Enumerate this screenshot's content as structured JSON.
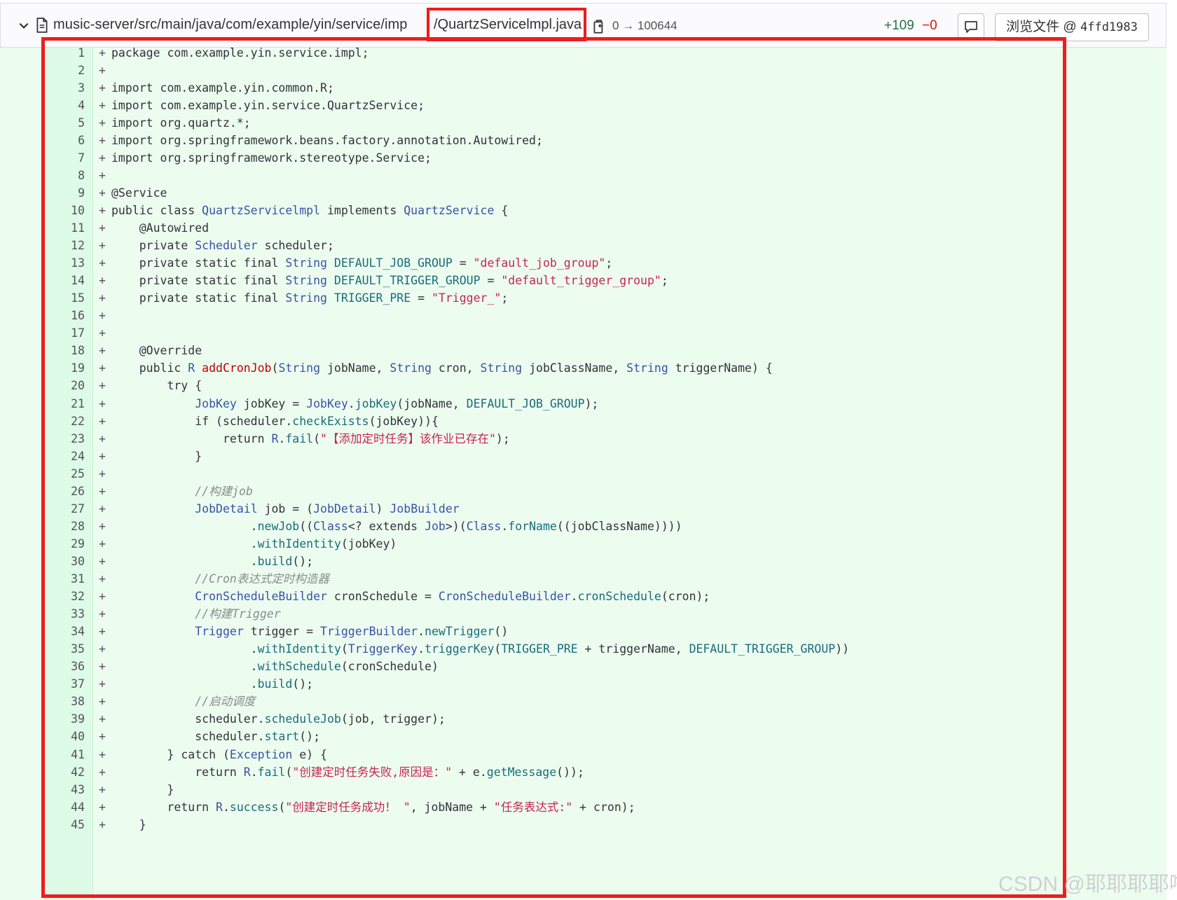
{
  "header": {
    "path": "music-server/src/main/java/com/example/yin/service/imp",
    "filename": "/QuartzServicelmpl.java",
    "mode_change": "0 → 100644",
    "added": "+109",
    "removed": "−0",
    "view_label": "浏览文件 @ ",
    "view_sha": "4ffd1983"
  },
  "code_lines": [
    {
      "n": "1",
      "pm": "+",
      "t": "package com.example.yin.service.impl;"
    },
    {
      "n": "2",
      "pm": "+",
      "t": ""
    },
    {
      "n": "3",
      "pm": "+",
      "t": "import com.example.yin.common.R;"
    },
    {
      "n": "4",
      "pm": "+",
      "t": "import com.example.yin.service.QuartzService;"
    },
    {
      "n": "5",
      "pm": "+",
      "t": "import org.quartz.*;"
    },
    {
      "n": "6",
      "pm": "+",
      "t": "import org.springframework.beans.factory.annotation.Autowired;"
    },
    {
      "n": "7",
      "pm": "+",
      "t": "import org.springframework.stereotype.Service;"
    },
    {
      "n": "8",
      "pm": "+",
      "t": ""
    },
    {
      "n": "9",
      "pm": "+",
      "t": "@Service"
    },
    {
      "n": "10",
      "pm": "+",
      "t": "public class QuartzServicelmpl implements QuartzService {"
    },
    {
      "n": "11",
      "pm": "+",
      "t": "    @Autowired"
    },
    {
      "n": "12",
      "pm": "+",
      "t": "    private Scheduler scheduler;"
    },
    {
      "n": "13",
      "pm": "+",
      "t": "    private static final String DEFAULT_JOB_GROUP = \"default_job_group\";"
    },
    {
      "n": "14",
      "pm": "+",
      "t": "    private static final String DEFAULT_TRIGGER_GROUP = \"default_trigger_group\";"
    },
    {
      "n": "15",
      "pm": "+",
      "t": "    private static final String TRIGGER_PRE = \"Trigger_\";"
    },
    {
      "n": "16",
      "pm": "+",
      "t": ""
    },
    {
      "n": "17",
      "pm": "+",
      "t": ""
    },
    {
      "n": "18",
      "pm": "+",
      "t": "    @Override"
    },
    {
      "n": "19",
      "pm": "+",
      "t": "    public R addCronJob(String jobName, String cron, String jobClassName, String triggerName) {"
    },
    {
      "n": "20",
      "pm": "+",
      "t": "        try {"
    },
    {
      "n": "21",
      "pm": "+",
      "t": "            JobKey jobKey = JobKey.jobKey(jobName, DEFAULT_JOB_GROUP);"
    },
    {
      "n": "22",
      "pm": "+",
      "t": "            if (scheduler.checkExists(jobKey)){"
    },
    {
      "n": "23",
      "pm": "+",
      "t": "                return R.fail(\"【添加定时任务】该作业已存在\");"
    },
    {
      "n": "24",
      "pm": "+",
      "t": "            }"
    },
    {
      "n": "25",
      "pm": "+",
      "t": ""
    },
    {
      "n": "26",
      "pm": "+",
      "t": "            //构建job"
    },
    {
      "n": "27",
      "pm": "+",
      "t": "            JobDetail job = (JobDetail) JobBuilder"
    },
    {
      "n": "28",
      "pm": "+",
      "t": "                    .newJob((Class<? extends Job>)(Class.forName((jobClassName))))"
    },
    {
      "n": "29",
      "pm": "+",
      "t": "                    .withIdentity(jobKey)"
    },
    {
      "n": "30",
      "pm": "+",
      "t": "                    .build();"
    },
    {
      "n": "31",
      "pm": "+",
      "t": "            //Cron表达式定时构造器"
    },
    {
      "n": "32",
      "pm": "+",
      "t": "            CronScheduleBuilder cronSchedule = CronScheduleBuilder.cronSchedule(cron);"
    },
    {
      "n": "33",
      "pm": "+",
      "t": "            //构建Trigger"
    },
    {
      "n": "34",
      "pm": "+",
      "t": "            Trigger trigger = TriggerBuilder.newTrigger()"
    },
    {
      "n": "35",
      "pm": "+",
      "t": "                    .withIdentity(TriggerKey.triggerKey(TRIGGER_PRE + triggerName, DEFAULT_TRIGGER_GROUP))"
    },
    {
      "n": "36",
      "pm": "+",
      "t": "                    .withSchedule(cronSchedule)"
    },
    {
      "n": "37",
      "pm": "+",
      "t": "                    .build();"
    },
    {
      "n": "38",
      "pm": "+",
      "t": "            //启动调度"
    },
    {
      "n": "39",
      "pm": "+",
      "t": "            scheduler.scheduleJob(job, trigger);"
    },
    {
      "n": "40",
      "pm": "+",
      "t": "            scheduler.start();"
    },
    {
      "n": "41",
      "pm": "+",
      "t": "        } catch (Exception e) {"
    },
    {
      "n": "42",
      "pm": "+",
      "t": "            return R.fail(\"创建定时任务失败,原因是：\" + e.getMessage());"
    },
    {
      "n": "43",
      "pm": "+",
      "t": "        }"
    },
    {
      "n": "44",
      "pm": "+",
      "t": "        return R.success(\"创建定时任务成功！ \", jobName + \"任务表达式:\" + cron);"
    },
    {
      "n": "45",
      "pm": "+",
      "t": "    }"
    }
  ],
  "watermark": "CSDN @耶耶耶耶噜",
  "colors": {
    "added_bg": "#ecfdf0",
    "gutter_bg": "#ddfbe6",
    "highlight_box": "#ee1d1d",
    "added_count": "#217645",
    "removed_count": "#c91c00"
  }
}
